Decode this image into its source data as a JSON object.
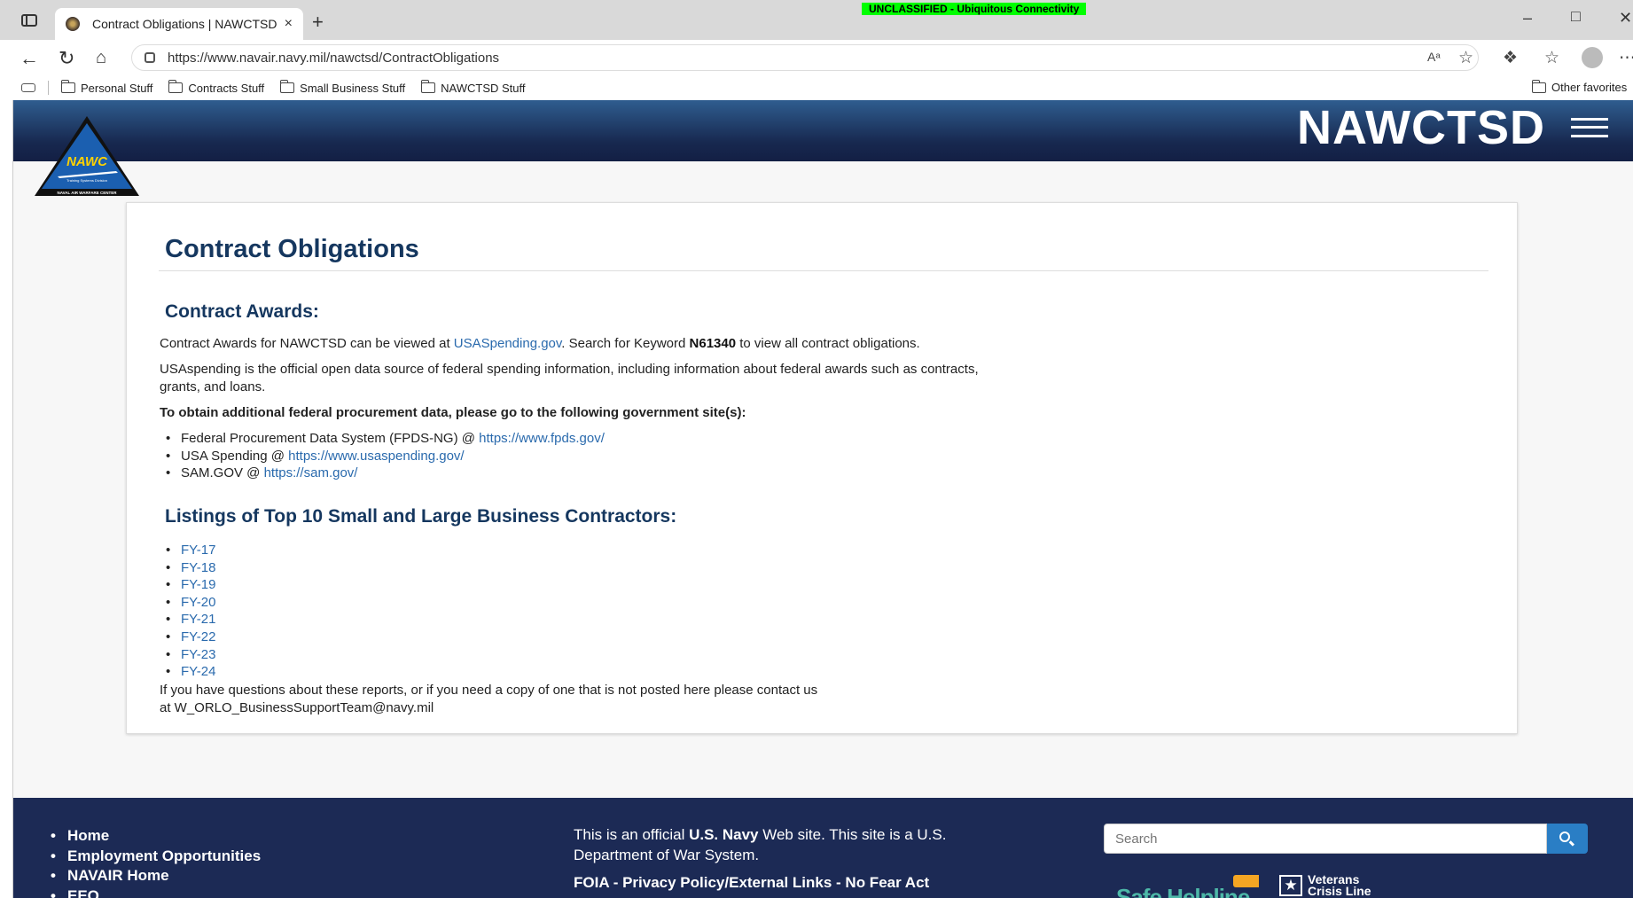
{
  "browser": {
    "tab_title": "Contract Obligations | NAWCTSD",
    "tab_close": "×",
    "new_tab": "+",
    "classification_banner": "UNCLASSIFIED - Ubiquitous Connectivity",
    "classification_color": "#00ff00",
    "url": "https://www.navair.navy.mil/nawctsd/ContractObligations",
    "favorites": [
      "Personal Stuff",
      "Contracts Stuff",
      "Small Business Stuff",
      "NAWCTSD Stuff"
    ],
    "other_favorites": "Other favorites",
    "icons": {
      "back": "back-arrow-icon",
      "refresh": "refresh-icon",
      "home": "home-icon",
      "read_aloud": "read-aloud-icon",
      "favorite": "star-icon",
      "extensions": "extensions-icon",
      "favorites_list": "favorites-icon",
      "profile": "profile-icon",
      "more": "more-icon"
    }
  },
  "site": {
    "name": "NAWCTSD",
    "header_color": "#17284f",
    "logo_text": "NAWC",
    "logo_subtext": "Training Systems Division",
    "logo_ring_text": "NAVAL AIR WARFARE CENTER"
  },
  "content": {
    "title": "Contract Obligations",
    "awards_heading": "Contract Awards:",
    "awards_text_1": "Contract Awards for NAWCTSD can be viewed at ",
    "awards_link": "USASpending.gov",
    "awards_text_2": ". Search for Keyword ",
    "keyword": "N61340",
    "awards_text_3": " to view all contract obligations.",
    "usaspending_desc": "USAspending is the official open data source of federal spending information, including information about federal awards such as contracts, grants, and loans.",
    "obtain_text": "To obtain additional federal procurement data, please go to the following government site(s):",
    "sites": [
      {
        "label": "Federal Procurement Data System (FPDS-NG) @ ",
        "link": "https://www.fpds.gov/"
      },
      {
        "label": "USA Spending @ ",
        "link": "https://www.usaspending.gov/"
      },
      {
        "label": "SAM.GOV @ ",
        "link": "https://sam.gov/"
      }
    ],
    "listings_heading": "Listings of Top 10 Small and Large Business Contractors:",
    "fiscal_years": [
      "FY-17",
      "FY-18",
      "FY-19",
      "FY-20",
      "FY-21",
      "FY-22",
      "FY-23",
      "FY-24"
    ],
    "contact_text_1": "If you have questions about these reports, or if you need a copy of one that is not posted here please contact us",
    "contact_text_2": "at W_ORLO_BusinessSupportTeam@navy.mil",
    "link_color": "#2a6aad",
    "heading_color": "#15375f"
  },
  "footer": {
    "links": [
      "Home",
      "Employment Opportunities",
      "NAVAIR Home",
      "EEO"
    ],
    "official_1": "This is an official ",
    "official_bold": "U.S. Navy",
    "official_2": " Web site. This site is a U.S. Department of War System.",
    "legal": "FOIA - Privacy Policy/External Links - No Fear Act",
    "search_placeholder": "Search",
    "safe_helpline": "Safe Helpline",
    "veterans_1": "Veterans",
    "veterans_2": "Crisis Line",
    "background_color": "#1c2a55"
  }
}
